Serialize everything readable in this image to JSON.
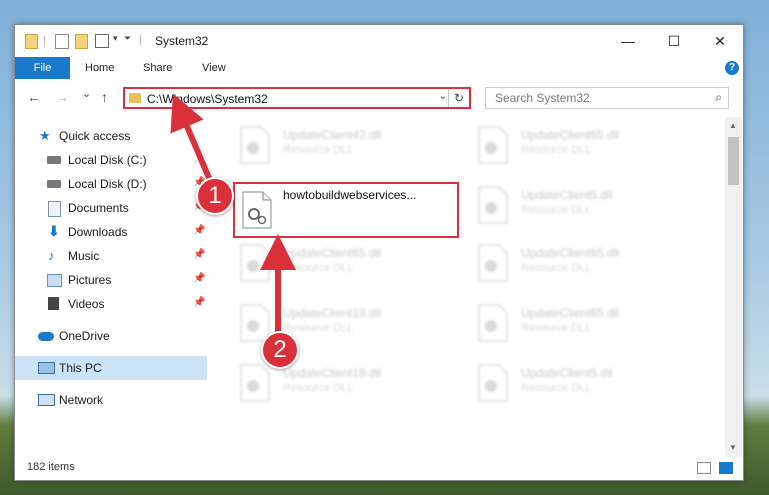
{
  "window": {
    "title": "System32",
    "controls": {
      "minimize": "—",
      "maximize": "☐",
      "close": "✕"
    }
  },
  "ribbon": {
    "tabs": [
      "File",
      "Home",
      "Share",
      "View"
    ],
    "help": "?"
  },
  "nav": {
    "back": "←",
    "forward": "→",
    "recent": "⌄",
    "up": "↑",
    "address": "C:\\Windows\\System32",
    "refresh": "↻",
    "search_placeholder": "Search System32",
    "search_icon": "⌕"
  },
  "sidebar": {
    "items": [
      {
        "label": "Quick access",
        "icon": "star-icon"
      },
      {
        "label": "Local Disk (C:)",
        "icon": "drive-icon",
        "pinned": true
      },
      {
        "label": "Local Disk (D:)",
        "icon": "drive-icon",
        "pinned": true
      },
      {
        "label": "Documents",
        "icon": "documents-icon",
        "pinned": true
      },
      {
        "label": "Downloads",
        "icon": "downloads-icon",
        "pinned": true
      },
      {
        "label": "Music",
        "icon": "music-icon",
        "pinned": true
      },
      {
        "label": "Pictures",
        "icon": "pictures-icon",
        "pinned": true
      },
      {
        "label": "Videos",
        "icon": "videos-icon",
        "pinned": true
      },
      {
        "label": "OneDrive",
        "icon": "cloud-icon"
      },
      {
        "label": "This PC",
        "icon": "computer-icon",
        "selected": true
      },
      {
        "label": "Network",
        "icon": "network-icon"
      }
    ]
  },
  "files": [
    {
      "name": "UpdateClient42.dll",
      "type": "Resource DLL"
    },
    {
      "name": "UpdateClient65.dll",
      "type": "Resource DLL"
    },
    {
      "name": "howtobuildwebservices...",
      "type": ""
    },
    {
      "name": "UpdateClient5.dll",
      "type": "Resource DLL"
    },
    {
      "name": "UpdateClient65.dll",
      "type": "Resource DLL"
    },
    {
      "name": "UpdateClient65.dll",
      "type": "Resource DLL"
    },
    {
      "name": "UpdateClient19.dll",
      "type": "Resource DLL"
    },
    {
      "name": "UpdateClient65.dll",
      "type": "Resource DLL"
    },
    {
      "name": "UpdateClient19.dll",
      "type": "Resource DLL"
    },
    {
      "name": "UpdateClient5.dll",
      "type": "Resource DLL"
    }
  ],
  "status": {
    "count": "182 items"
  },
  "callouts": {
    "one": "1",
    "two": "2"
  },
  "colors": {
    "accent": "#1979ca",
    "highlight": "#d9303a",
    "selected": "#cce4f7"
  }
}
